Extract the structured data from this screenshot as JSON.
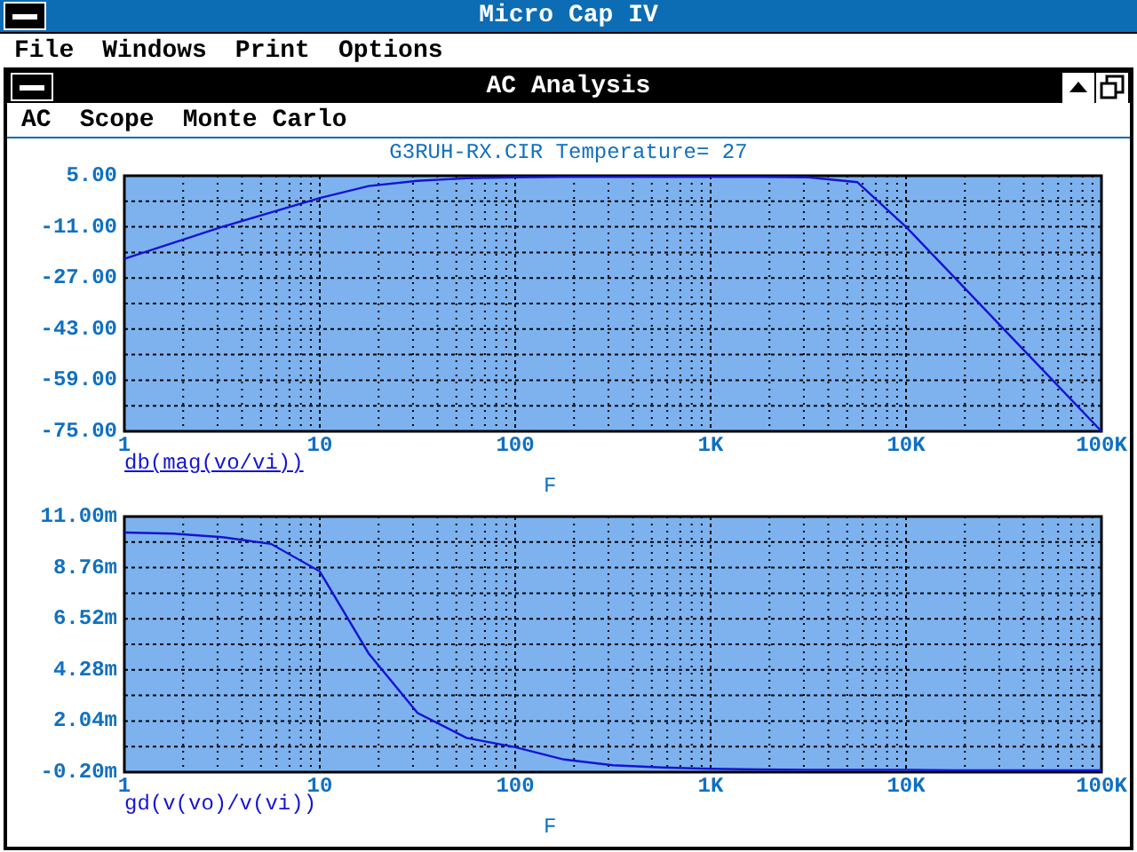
{
  "app": {
    "title": "Micro Cap IV",
    "menu": [
      "File",
      "Windows",
      "Print",
      "Options"
    ]
  },
  "window": {
    "title": "AC Analysis",
    "menu": [
      "AC",
      "Scope",
      "Monte Carlo"
    ]
  },
  "plots": [
    {
      "label_underlined": true,
      "chart_data": {
        "type": "line",
        "title": "G3RUH-RX.CIR Temperature= 27",
        "xlabel": "F",
        "categories": [
          "1",
          null,
          null,
          null,
          "10",
          null,
          null,
          null,
          "100",
          null,
          null,
          null,
          "1K",
          null,
          null,
          null,
          "10K",
          null,
          null,
          null,
          "100K"
        ],
        "series": [
          {
            "name": "db(mag(vo/vi))",
            "color": "#1414d2",
            "values": [
              -21,
              -16,
              -11,
              -6.5,
              -2,
              1.8,
              3.4,
              4.2,
              4.5,
              4.6,
              4.6,
              4.6,
              4.6,
              4.6,
              4.5,
              3,
              -11,
              -27,
              -43,
              -59,
              -75
            ]
          }
        ],
        "ylim": [
          -75,
          5
        ],
        "grid": true,
        "yticks": [
          {
            "value": 5,
            "label": "5.00"
          },
          {
            "value": -11,
            "label": "-11.00"
          },
          {
            "value": -27,
            "label": "-27.00"
          },
          {
            "value": -43,
            "label": "-43.00"
          },
          {
            "value": -59,
            "label": "-59.00"
          },
          {
            "value": -75,
            "label": "-75.00"
          }
        ]
      }
    },
    {
      "label_underlined": false,
      "chart_data": {
        "type": "line",
        "xlabel": "F",
        "categories": [
          "1",
          null,
          null,
          null,
          "10",
          null,
          null,
          null,
          "100",
          null,
          null,
          null,
          "1K",
          null,
          null,
          null,
          "10K",
          null,
          null,
          null,
          "100K"
        ],
        "series": [
          {
            "name": "gd(v(vo)/v(vi))",
            "color": "#1414d2",
            "values": [
              10.3,
              10.25,
              10.1,
              9.8,
              8.6,
              5.0,
              2.4,
              1.3,
              0.9,
              0.35,
              0.1,
              0.0,
              -0.05,
              -0.08,
              -0.1,
              -0.1,
              -0.1,
              -0.12,
              -0.12,
              -0.12,
              -0.12
            ]
          }
        ],
        "ylim": [
          -0.2,
          11
        ],
        "grid": true,
        "yticks": [
          {
            "value": 11,
            "label": "11.00m"
          },
          {
            "value": 8.76,
            "label": "8.76m"
          },
          {
            "value": 6.52,
            "label": "6.52m"
          },
          {
            "value": 4.28,
            "label": "4.28m"
          },
          {
            "value": 2.04,
            "label": "2.04m"
          },
          {
            "value": -0.2,
            "label": "-0.20m"
          }
        ]
      }
    }
  ]
}
